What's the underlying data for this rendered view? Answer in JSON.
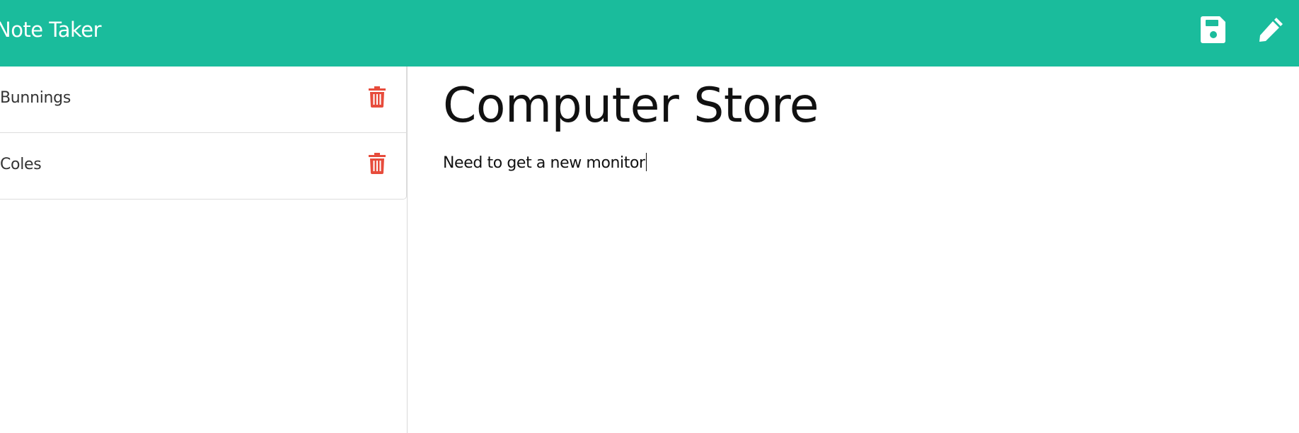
{
  "app": {
    "title": "Note Taker",
    "accent_color": "#1abc9c",
    "delete_color": "#e74c3c"
  },
  "toolbar": {
    "save_icon": "save-icon",
    "new_note_icon": "pencil-icon"
  },
  "sidebar": {
    "notes": [
      {
        "label": "Bunnings",
        "delete_icon": "trash-icon"
      },
      {
        "label": "Coles",
        "delete_icon": "trash-icon"
      }
    ]
  },
  "editor": {
    "title": "Computer Store",
    "text": "Need to get a new monitor"
  }
}
